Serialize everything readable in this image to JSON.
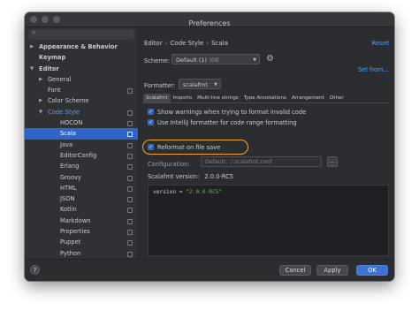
{
  "window": {
    "title": "Preferences"
  },
  "sidebar": {
    "search_icon": "search-icon",
    "items": [
      {
        "label": "Appearance & Behavior",
        "bold": true,
        "arrow": "▶"
      },
      {
        "label": "Keymap",
        "bold": true,
        "arrow": ""
      },
      {
        "label": "Editor",
        "bold": true,
        "arrow": "▼"
      },
      {
        "label": "General",
        "arrow": "▶"
      },
      {
        "label": "Font",
        "arrow": ""
      },
      {
        "label": "Color Scheme",
        "arrow": "▶"
      },
      {
        "label": "Code Style",
        "arrow": "▼",
        "blue": true
      },
      {
        "label": "HOCON",
        "arrow": ""
      },
      {
        "label": "Scala",
        "arrow": "",
        "selected": true
      },
      {
        "label": "Java",
        "arrow": ""
      },
      {
        "label": "EditorConfig",
        "arrow": ""
      },
      {
        "label": "Erlang",
        "arrow": ""
      },
      {
        "label": "Groovy",
        "arrow": ""
      },
      {
        "label": "HTML",
        "arrow": ""
      },
      {
        "label": "JSON",
        "arrow": ""
      },
      {
        "label": "Kotlin",
        "arrow": ""
      },
      {
        "label": "Markdown",
        "arrow": ""
      },
      {
        "label": "Properties",
        "arrow": ""
      },
      {
        "label": "Puppet",
        "arrow": ""
      },
      {
        "label": "Python",
        "arrow": ""
      }
    ]
  },
  "header": {
    "breadcrumb": [
      "Editor",
      "Code Style",
      "Scala"
    ],
    "breadcrumb_sep": "›",
    "reset": "Reset"
  },
  "scheme": {
    "label": "Scheme:",
    "value": "Default (1)",
    "tag": "IDE",
    "set_from": "Set from..."
  },
  "formatter": {
    "label": "Formatter:",
    "value": "scalafmt"
  },
  "tabs": [
    "Scalafmt",
    "Imports",
    "Multi-line strings",
    "Type Annotations",
    "Arrangement",
    "Other"
  ],
  "options": [
    {
      "label": "Show warnings when trying to format invalid code",
      "checked": true
    },
    {
      "label": "Use IntelliJ formatter for code range formatting",
      "checked": true
    },
    {
      "label": "Reformat on file save",
      "checked": true
    }
  ],
  "configuration": {
    "label": "Configuration:",
    "placeholder": "Default: ./.scalafmt.conf",
    "browse": "..."
  },
  "version": {
    "label": "Scalafmt version:",
    "value": "2.0.0-RC5"
  },
  "editor": {
    "code_key": "version = ",
    "code_value": "\"2.0.0-RC5\""
  },
  "footer": {
    "help": "?",
    "cancel": "Cancel",
    "apply": "Apply",
    "ok": "OK"
  },
  "colors": {
    "accent": "#2f65ca",
    "link": "#589df6",
    "highlight": "#f5a623",
    "background": "#2b2d30"
  }
}
